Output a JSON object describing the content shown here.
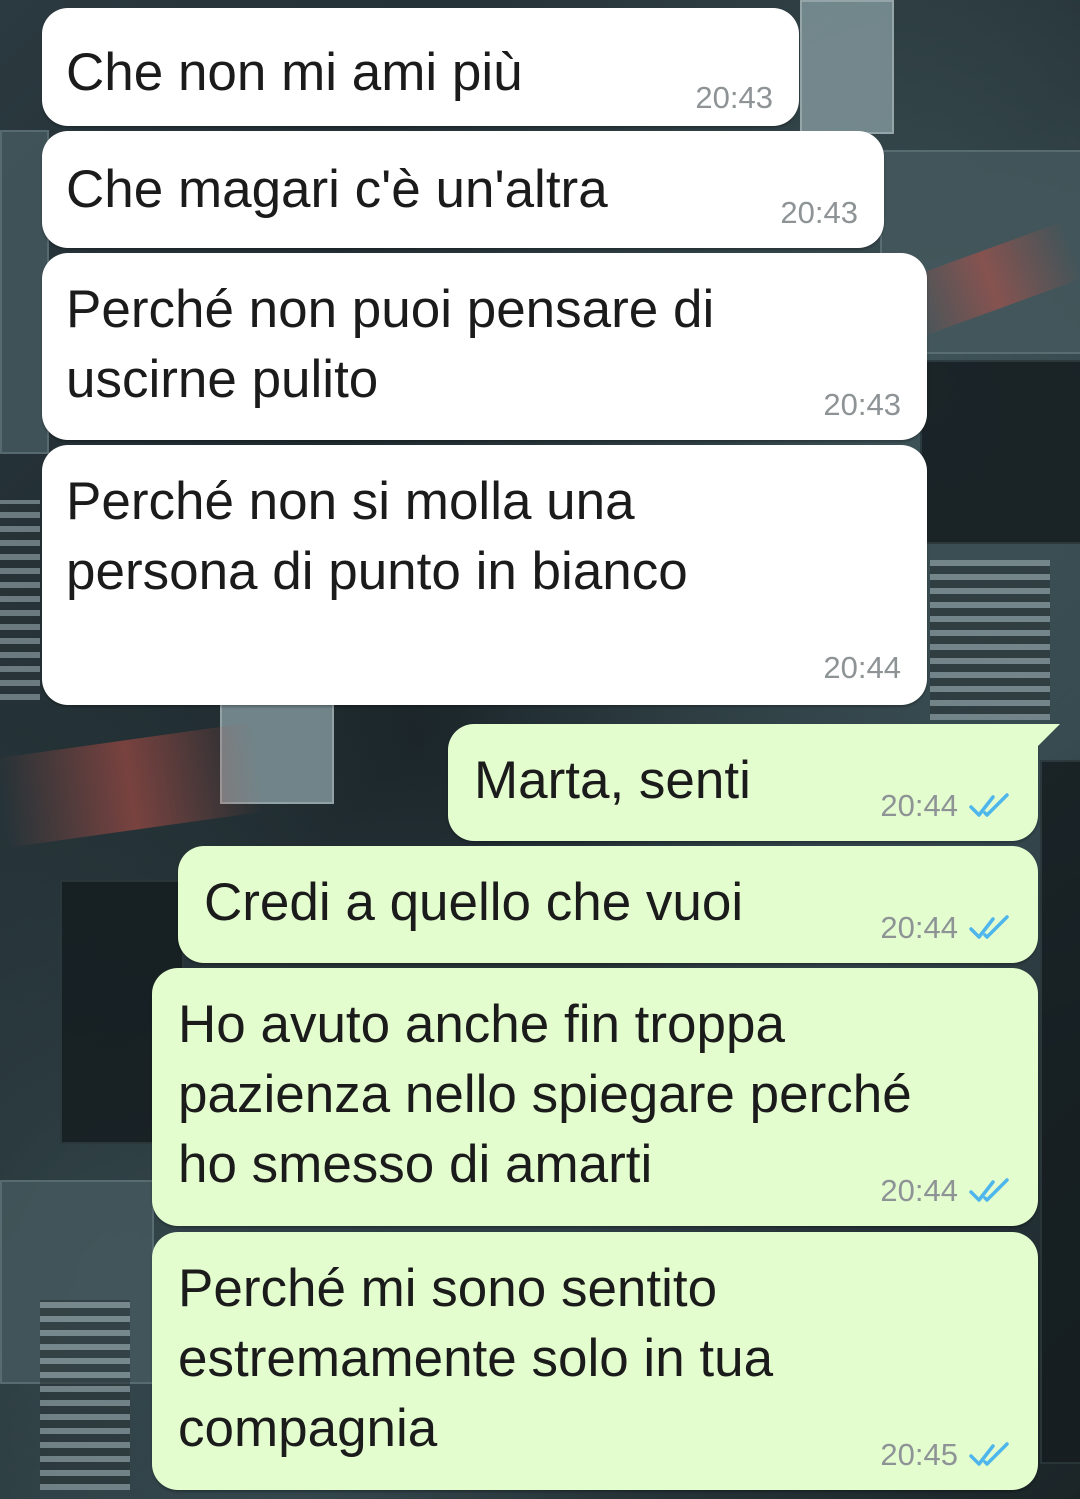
{
  "colors": {
    "incoming_bubble": "#ffffff",
    "outgoing_bubble": "#e4fdcf",
    "timestamp": "#8e9396",
    "read_ticks": "#4fb6ec"
  },
  "messages": [
    {
      "direction": "incoming",
      "text": "Che non mi ami più",
      "time": "20:43"
    },
    {
      "direction": "incoming",
      "text": "Che magari c'è un'altra",
      "time": "20:43"
    },
    {
      "direction": "incoming",
      "text": "Perché non puoi pensare di\nuscirne pulito",
      "time": "20:43"
    },
    {
      "direction": "incoming",
      "text": "Perché non si molla una\npersona di punto in bianco",
      "time": "20:44"
    },
    {
      "direction": "outgoing",
      "text": "Marta, senti",
      "time": "20:44",
      "status_icon": "double-check-read-icon"
    },
    {
      "direction": "outgoing",
      "text": "Credi a quello che vuoi",
      "time": "20:44",
      "status_icon": "double-check-read-icon"
    },
    {
      "direction": "outgoing",
      "text": "Ho avuto anche fin troppa\npazienza nello spiegare perché\nho smesso di amarti",
      "time": "20:44",
      "status_icon": "double-check-read-icon"
    },
    {
      "direction": "outgoing",
      "text": "Perché mi sono sentito\nestremamente solo in tua\ncompagnia",
      "time": "20:45",
      "status_icon": "double-check-read-icon"
    }
  ]
}
